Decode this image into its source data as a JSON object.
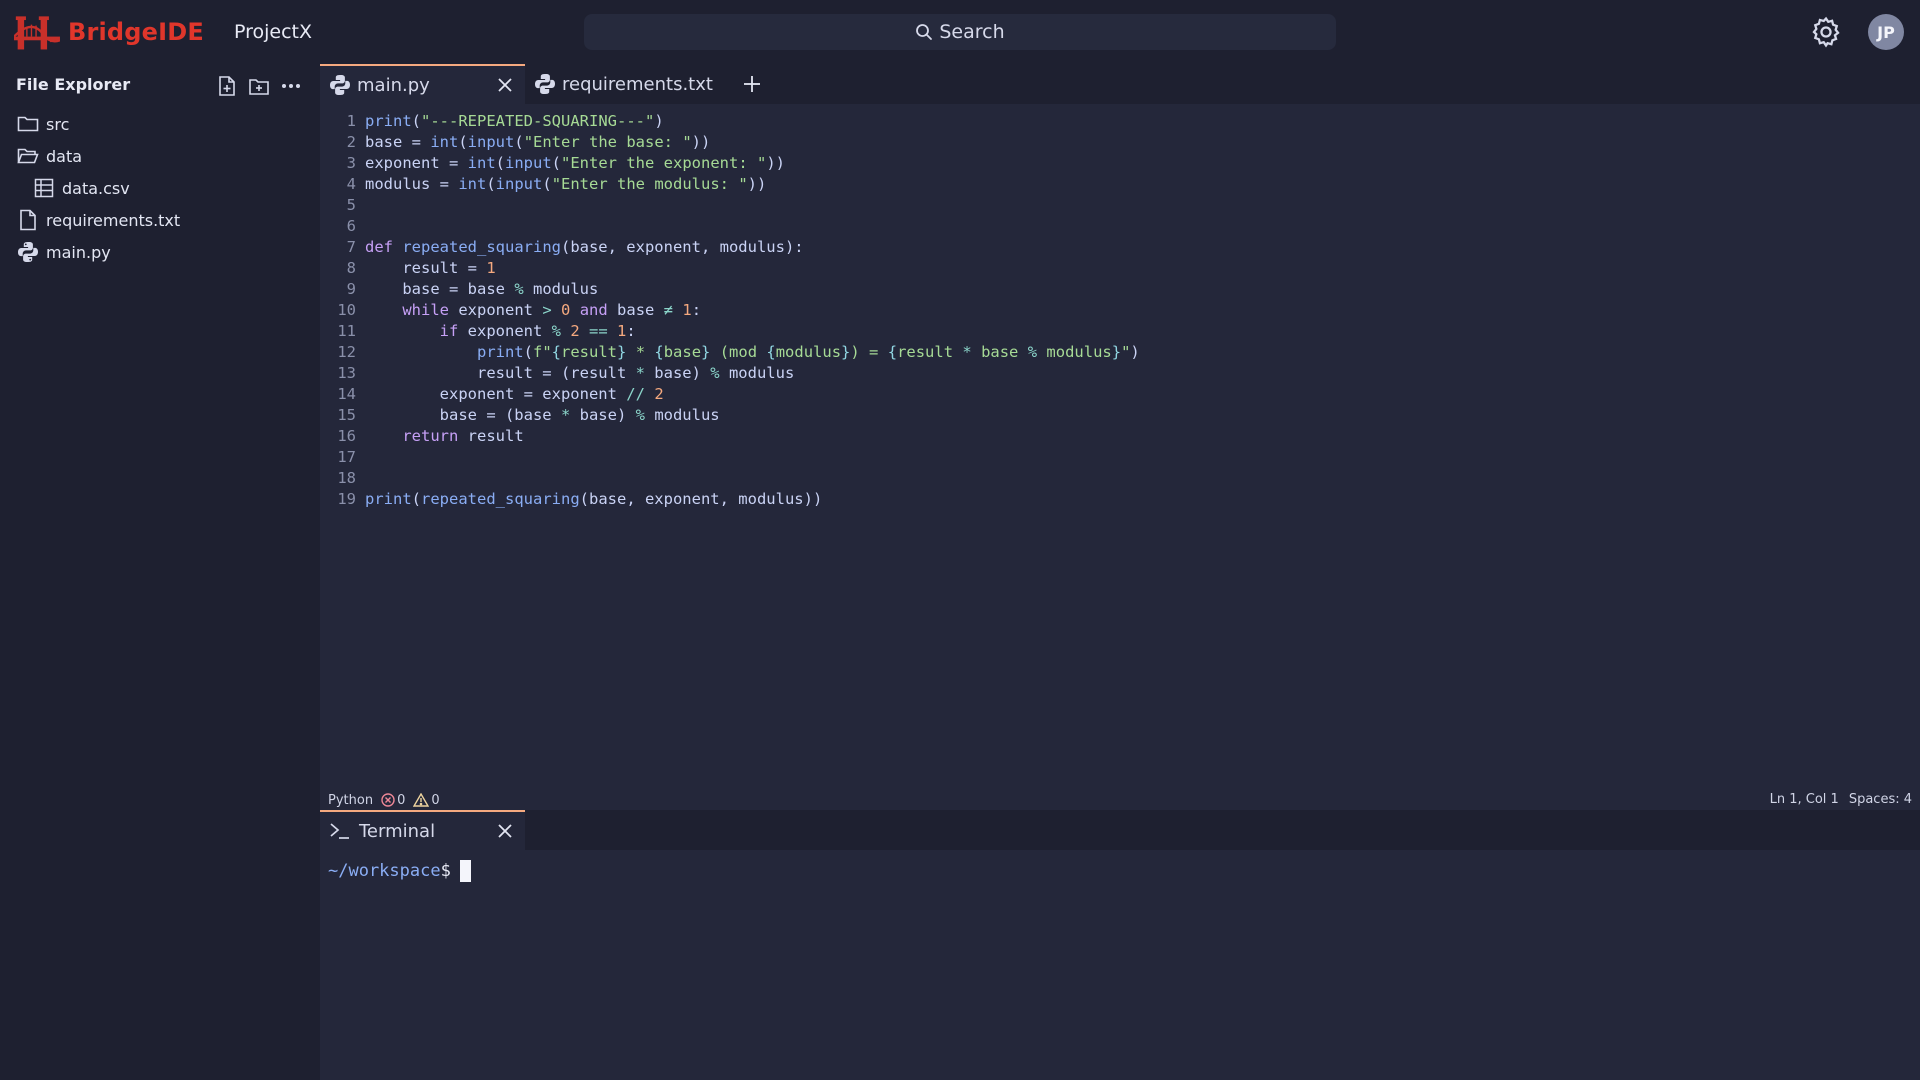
{
  "app": {
    "name": "BridgeIDE",
    "project": "ProjectX",
    "search_label": "Search",
    "avatar_initials": "JP",
    "brand_color": "#e0362b",
    "accent_color": "#f5a97f"
  },
  "sidebar": {
    "title": "File Explorer",
    "actions": [
      "new-file-icon",
      "new-folder-icon",
      "more-icon"
    ],
    "items": [
      {
        "label": "src",
        "icon": "folder-icon",
        "depth": 0
      },
      {
        "label": "data",
        "icon": "folder-open-icon",
        "depth": 0
      },
      {
        "label": "data.csv",
        "icon": "table-icon",
        "depth": 1
      },
      {
        "label": "requirements.txt",
        "icon": "file-icon",
        "depth": 0
      },
      {
        "label": "main.py",
        "icon": "python-icon",
        "depth": 0
      }
    ]
  },
  "tabs": [
    {
      "label": "main.py",
      "icon": "python-icon",
      "active": true
    },
    {
      "label": "requirements.txt",
      "icon": "python-icon",
      "active": false
    }
  ],
  "editor": {
    "lines": [
      "print(\"---REPEATED-SQUARING---\")",
      "base = int(input(\"Enter the base: \"))",
      "exponent = int(input(\"Enter the exponent: \"))",
      "modulus = int(input(\"Enter the modulus: \"))",
      "",
      "",
      "def repeated_squaring(base, exponent, modulus):",
      "    result = 1",
      "    base = base % modulus",
      "    while exponent > 0 and base ≠ 1:",
      "        if exponent % 2 == 1:",
      "            print(f\"{result} * {base} (mod {modulus}) = {result * base % modulus}\")",
      "            result = (result * base) % modulus",
      "        exponent = exponent // 2",
      "        base = (base * base) % modulus",
      "    return result",
      "",
      "",
      "print(repeated_squaring(base, exponent, modulus))"
    ]
  },
  "status": {
    "language": "Python",
    "errors": "0",
    "warnings": "0",
    "position": "Ln 1, Col 1",
    "spaces": "Spaces: 4"
  },
  "terminal": {
    "tab_label": "Terminal",
    "prompt_path": "~/workspace",
    "prompt_symbol": "$"
  }
}
